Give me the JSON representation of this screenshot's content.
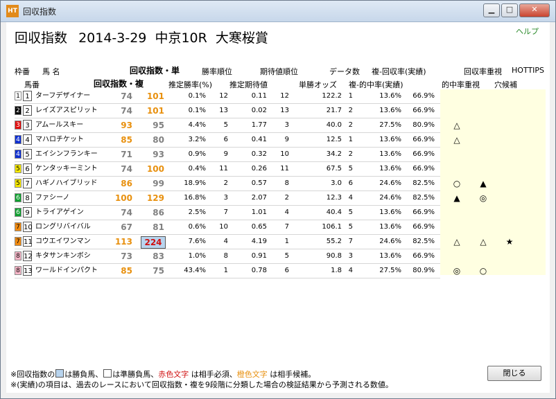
{
  "window": {
    "title": "回収指数",
    "app_icon": "HT"
  },
  "help_label": "ヘルプ",
  "race": {
    "prefix": "回収指数",
    "date": "2014-3-29",
    "place_race": "中京10R",
    "name": "大寒桜賞"
  },
  "headers": {
    "waku": "枠番",
    "uma": "馬 名",
    "umaban": "馬番",
    "idx_single": "回収指数・単",
    "idx_multi": "回収指数・複",
    "win_rank": "勝率順位",
    "est_win_rate": "推定勝率(%)",
    "ev_rank": "期待値順位",
    "est_ev": "推定期待値",
    "data_count": "データ数",
    "win_odds": "単勝オッズ",
    "fuku_return": "複-回収率(実績)",
    "fuku_hit": "複-的中率(実績)",
    "return_focus": "回収率重視",
    "hit_focus": "的中率重視",
    "hottips": "HOTTIPS",
    "longshot": "穴候補"
  },
  "colors": {
    "orange": "#e8900e",
    "gray": "#808080",
    "red": "#d01010",
    "highlight_blue": "#b8d4ee",
    "mark_bg": "#ffffe1"
  },
  "rows": [
    {
      "waku": "1",
      "waku_bg": "#ffffff",
      "waku_fg": "#000000",
      "num": "1",
      "name": "ターフデザイナー",
      "tan": "74",
      "tan_color": "#808080",
      "fuku": "101",
      "fuku_color": "#e8900e",
      "fuku_box": false,
      "win_rate": "0.1%",
      "win_rank": "12",
      "ev": "0.11",
      "ev_rank": "12",
      "odds": "122.2",
      "count": "1",
      "hit": "13.6%",
      "ret": "66.9%",
      "m1": "",
      "m2": "",
      "m3": ""
    },
    {
      "waku": "2",
      "waku_bg": "#000000",
      "waku_fg": "#ffffff",
      "num": "2",
      "name": "レイズアスピリット",
      "tan": "74",
      "tan_color": "#808080",
      "fuku": "101",
      "fuku_color": "#e8900e",
      "fuku_box": false,
      "win_rate": "0.1%",
      "win_rank": "13",
      "ev": "0.02",
      "ev_rank": "13",
      "odds": "21.7",
      "count": "2",
      "hit": "13.6%",
      "ret": "66.9%",
      "m1": "",
      "m2": "",
      "m3": ""
    },
    {
      "waku": "3",
      "waku_bg": "#e01010",
      "waku_fg": "#ffffff",
      "num": "3",
      "name": "アムールスキー",
      "tan": "93",
      "tan_color": "#e8900e",
      "fuku": "95",
      "fuku_color": "#808080",
      "fuku_box": false,
      "win_rate": "4.4%",
      "win_rank": "5",
      "ev": "1.77",
      "ev_rank": "3",
      "odds": "40.0",
      "count": "2",
      "hit": "27.5%",
      "ret": "80.9%",
      "m1": "△",
      "m2": "",
      "m3": ""
    },
    {
      "waku": "4",
      "waku_bg": "#1030d0",
      "waku_fg": "#ffffff",
      "num": "4",
      "name": "マハロチケット",
      "tan": "85",
      "tan_color": "#e8900e",
      "fuku": "80",
      "fuku_color": "#808080",
      "fuku_box": false,
      "win_rate": "3.2%",
      "win_rank": "6",
      "ev": "0.41",
      "ev_rank": "9",
      "odds": "12.5",
      "count": "1",
      "hit": "13.6%",
      "ret": "66.9%",
      "m1": "△",
      "m2": "",
      "m3": ""
    },
    {
      "waku": "4",
      "waku_bg": "#1030d0",
      "waku_fg": "#ffffff",
      "num": "5",
      "name": "エイシンフランキー",
      "tan": "71",
      "tan_color": "#808080",
      "fuku": "93",
      "fuku_color": "#808080",
      "fuku_box": false,
      "win_rate": "0.9%",
      "win_rank": "9",
      "ev": "0.32",
      "ev_rank": "10",
      "odds": "34.2",
      "count": "2",
      "hit": "13.6%",
      "ret": "66.9%",
      "m1": "",
      "m2": "",
      "m3": ""
    },
    {
      "waku": "5",
      "waku_bg": "#f5e800",
      "waku_fg": "#000000",
      "num": "6",
      "name": "ケンタッキーミント",
      "tan": "74",
      "tan_color": "#808080",
      "fuku": "100",
      "fuku_color": "#e8900e",
      "fuku_box": false,
      "win_rate": "0.4%",
      "win_rank": "11",
      "ev": "0.26",
      "ev_rank": "11",
      "odds": "67.5",
      "count": "5",
      "hit": "13.6%",
      "ret": "66.9%",
      "m1": "",
      "m2": "",
      "m3": ""
    },
    {
      "waku": "5",
      "waku_bg": "#f5e800",
      "waku_fg": "#000000",
      "num": "7",
      "name": "ハギノハイブリッド",
      "tan": "86",
      "tan_color": "#e8900e",
      "fuku": "99",
      "fuku_color": "#808080",
      "fuku_box": false,
      "win_rate": "18.9%",
      "win_rank": "2",
      "ev": "0.57",
      "ev_rank": "8",
      "odds": "3.0",
      "count": "6",
      "hit": "24.6%",
      "ret": "82.5%",
      "m1": "○",
      "m2": "▲",
      "m3": ""
    },
    {
      "waku": "6",
      "waku_bg": "#10a030",
      "waku_fg": "#ffffff",
      "num": "8",
      "name": "ファシーノ",
      "tan": "100",
      "tan_color": "#e8900e",
      "fuku": "129",
      "fuku_color": "#e8900e",
      "fuku_box": false,
      "win_rate": "16.8%",
      "win_rank": "3",
      "ev": "2.07",
      "ev_rank": "2",
      "odds": "12.3",
      "count": "4",
      "hit": "24.6%",
      "ret": "82.5%",
      "m1": "▲",
      "m2": "◎",
      "m3": ""
    },
    {
      "waku": "6",
      "waku_bg": "#10a030",
      "waku_fg": "#ffffff",
      "num": "9",
      "name": "トライアゲイン",
      "tan": "74",
      "tan_color": "#808080",
      "fuku": "86",
      "fuku_color": "#808080",
      "fuku_box": false,
      "win_rate": "2.5%",
      "win_rank": "7",
      "ev": "1.01",
      "ev_rank": "4",
      "odds": "40.4",
      "count": "5",
      "hit": "13.6%",
      "ret": "66.9%",
      "m1": "",
      "m2": "",
      "m3": ""
    },
    {
      "waku": "7",
      "waku_bg": "#f08a10",
      "waku_fg": "#000000",
      "num": "10",
      "name": "ロングリバイバル",
      "tan": "67",
      "tan_color": "#808080",
      "fuku": "81",
      "fuku_color": "#808080",
      "fuku_box": false,
      "win_rate": "0.6%",
      "win_rank": "10",
      "ev": "0.65",
      "ev_rank": "7",
      "odds": "106.1",
      "count": "5",
      "hit": "13.6%",
      "ret": "66.9%",
      "m1": "",
      "m2": "",
      "m3": ""
    },
    {
      "waku": "7",
      "waku_bg": "#f08a10",
      "waku_fg": "#000000",
      "num": "11",
      "name": "コウエイワンマン",
      "tan": "113",
      "tan_color": "#e8900e",
      "fuku": "224",
      "fuku_color": "#d01010",
      "fuku_box": true,
      "win_rate": "7.6%",
      "win_rank": "4",
      "ev": "4.19",
      "ev_rank": "1",
      "odds": "55.2",
      "count": "7",
      "hit": "24.6%",
      "ret": "82.5%",
      "m1": "△",
      "m2": "△",
      "m3": "★"
    },
    {
      "waku": "8",
      "waku_bg": "#f7b6c8",
      "waku_fg": "#000000",
      "num": "12",
      "name": "キタサンキンボシ",
      "tan": "73",
      "tan_color": "#808080",
      "fuku": "83",
      "fuku_color": "#808080",
      "fuku_box": false,
      "win_rate": "1.0%",
      "win_rank": "8",
      "ev": "0.91",
      "ev_rank": "5",
      "odds": "90.8",
      "count": "3",
      "hit": "13.6%",
      "ret": "66.9%",
      "m1": "",
      "m2": "",
      "m3": ""
    },
    {
      "waku": "8",
      "waku_bg": "#f7b6c8",
      "waku_fg": "#000000",
      "num": "13",
      "name": "ワールドインパクト",
      "tan": "85",
      "tan_color": "#e8900e",
      "fuku": "75",
      "fuku_color": "#808080",
      "fuku_box": false,
      "win_rate": "43.4%",
      "win_rank": "1",
      "ev": "0.78",
      "ev_rank": "6",
      "odds": "1.8",
      "count": "4",
      "hit": "27.5%",
      "ret": "80.9%",
      "m1": "◎",
      "m2": "○",
      "m3": ""
    }
  ],
  "footnote": {
    "line1_a": "※回収指数の",
    "line1_b": "は勝負馬、",
    "line1_c": "は準勝負馬、",
    "line1_red": "赤色文字",
    "line1_d": " は相手必須、",
    "line1_orange": "橙色文字",
    "line1_e": " は相手候補。",
    "line2": "※(実績)の項目は、過去のレースにおいて回収指数・複を9段階に分類した場合の検証結果から予測される数値。"
  },
  "close_button": "閉じる"
}
